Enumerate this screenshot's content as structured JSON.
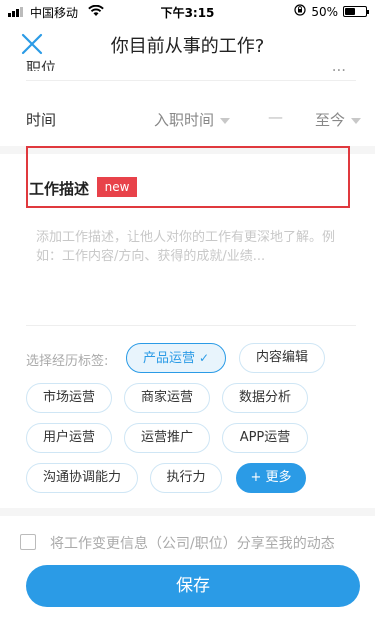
{
  "status_bar": {
    "carrier": "中国移动",
    "time": "下午3:15",
    "battery": "50%",
    "battery_level": 0.5
  },
  "nav": {
    "title": "你目前从事的工作?",
    "close_icon": "close-icon"
  },
  "cut_row": {
    "label": "职位",
    "value": "..."
  },
  "time_row": {
    "label": "时间",
    "start": "入职时间",
    "dash": "—",
    "end": "至今"
  },
  "description": {
    "title": "工作描述",
    "badge": "new",
    "placeholder": "添加工作描述，让他人对你的工作有更深地了解。例如：工作内容/方向、获得的成就/业绩..."
  },
  "tags": {
    "label": "选择经历标签:",
    "items": [
      {
        "label": "产品运营",
        "selected": true
      },
      {
        "label": "内容编辑",
        "selected": false
      },
      {
        "label": "市场运营",
        "selected": false
      },
      {
        "label": "商家运营",
        "selected": false
      },
      {
        "label": "数据分析",
        "selected": false
      },
      {
        "label": "用户运营",
        "selected": false
      },
      {
        "label": "运营推广",
        "selected": false
      },
      {
        "label": "APP运营",
        "selected": false
      },
      {
        "label": "沟通协调能力",
        "selected": false
      },
      {
        "label": "执行力",
        "selected": false
      }
    ],
    "more": "+ 更多",
    "check_icon": "check-icon"
  },
  "share": {
    "text": "将工作变更信息（公司/职位）分享至我的动态",
    "checked": false
  },
  "save": {
    "label": "保存"
  },
  "colors": {
    "accent": "#2b9be6",
    "highlight_border": "#e0393e",
    "badge": "#e8424a"
  }
}
